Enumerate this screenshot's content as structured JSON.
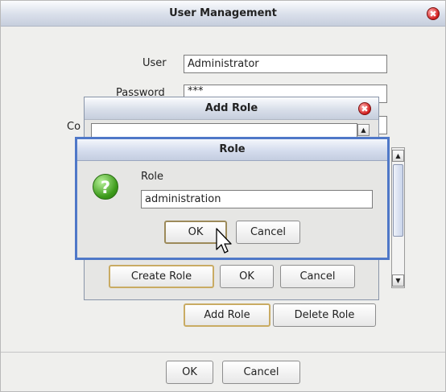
{
  "main_window": {
    "title": "User Management",
    "close_glyph": "✖",
    "user_label": "User",
    "user_value": "Administrator",
    "password_label": "Password",
    "password_value": "***",
    "confirm_label_partial": "Co",
    "add_role_label": "Add Role",
    "delete_role_label": "Delete Role",
    "ok_label": "OK",
    "cancel_label": "Cancel"
  },
  "add_role_dialog": {
    "title": "Add Role",
    "close_glyph": "✖",
    "create_role_label": "Create Role",
    "ok_label": "OK",
    "cancel_label": "Cancel"
  },
  "role_dialog": {
    "title": "Role",
    "icon": "question-icon",
    "icon_glyph": "?",
    "prompt_label": "Role",
    "role_value": "administration",
    "ok_label": "OK",
    "cancel_label": "Cancel"
  },
  "scroll_glyphs": {
    "up": "▲",
    "down": "▼"
  },
  "colors": {
    "title_gradient_top": "#fbfcfe",
    "title_gradient_bottom": "#c6cedd",
    "role_border": "#4f78c8",
    "default_button_border": "#c9ab63",
    "question_icon": "#3c9a1a",
    "close_icon": "#d21c1c"
  }
}
